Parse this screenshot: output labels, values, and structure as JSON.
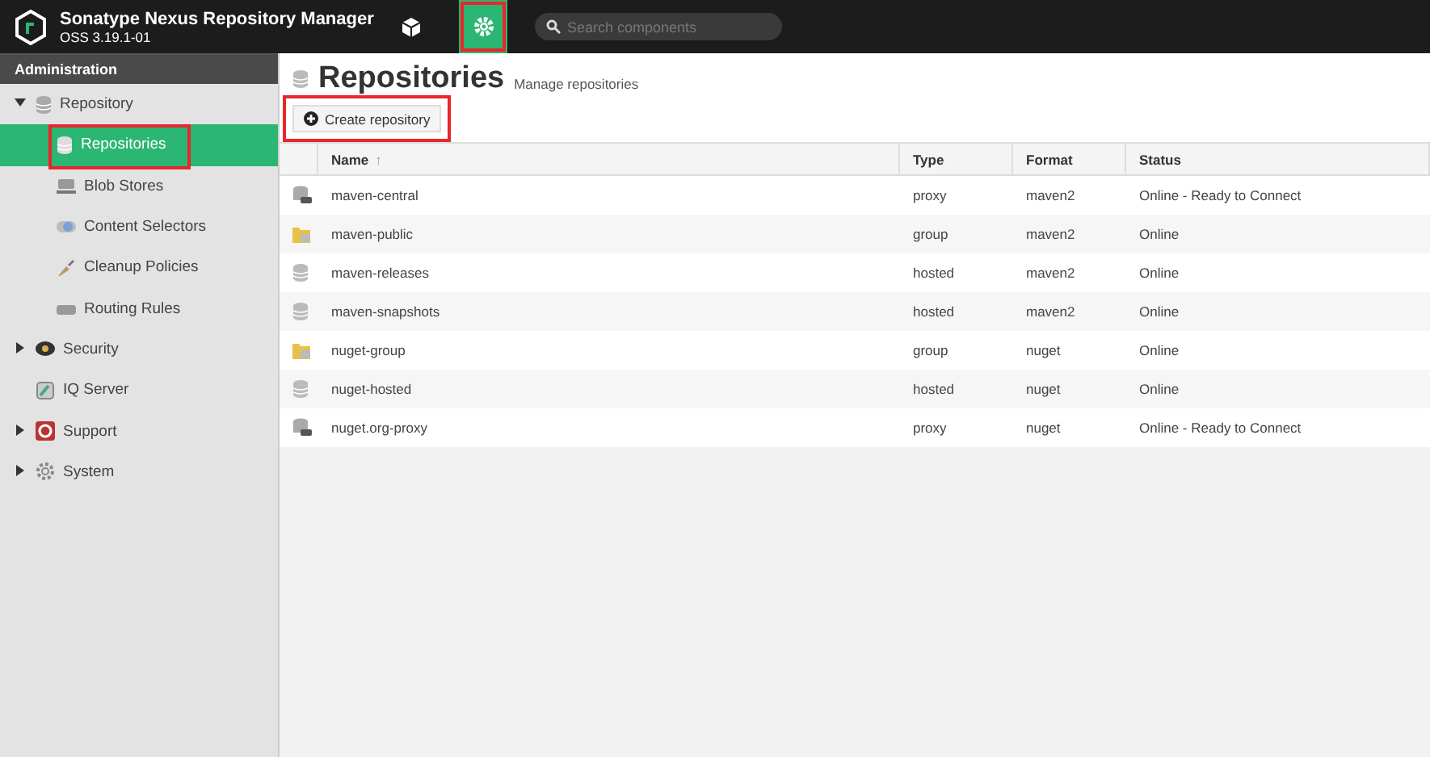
{
  "header": {
    "title": "Sonatype Nexus Repository Manager",
    "version": "OSS 3.19.1-01",
    "nav": [
      {
        "kind": "browse",
        "selected": false,
        "highlighted": false
      },
      {
        "kind": "admin",
        "selected": true,
        "highlighted": true
      }
    ],
    "search": {
      "placeholder": "Search components"
    }
  },
  "sidebar": {
    "title": "Administration",
    "items": [
      {
        "label": "Repository",
        "kind": "database",
        "expanded": true,
        "selected": false,
        "highlighted": false,
        "children": [
          {
            "label": "Repositories",
            "kind": "database",
            "selected": true,
            "highlighted": true
          },
          {
            "label": "Blob Stores",
            "kind": "server",
            "selected": false,
            "highlighted": false
          },
          {
            "label": "Content Selectors",
            "kind": "selector",
            "selected": false,
            "highlighted": false
          },
          {
            "label": "Cleanup Policies",
            "kind": "brush",
            "selected": false,
            "highlighted": false
          },
          {
            "label": "Routing Rules",
            "kind": "drive",
            "selected": false,
            "highlighted": false
          }
        ]
      },
      {
        "label": "Security",
        "kind": "badge",
        "expanded": false,
        "selected": false,
        "highlighted": false
      },
      {
        "label": "IQ Server",
        "kind": "iq",
        "selected": false,
        "highlighted": false
      },
      {
        "label": "Support",
        "kind": "lifebuoy",
        "expanded": false,
        "selected": false,
        "highlighted": false
      },
      {
        "label": "System",
        "kind": "gear",
        "expanded": false,
        "selected": false,
        "highlighted": false
      }
    ]
  },
  "page": {
    "title": "Repositories",
    "subtitle": "Manage repositories",
    "create_button": {
      "label": "Create repository",
      "highlighted": true
    }
  },
  "table": {
    "columns": [
      "Name",
      "Type",
      "Format",
      "Status"
    ],
    "sort_indicator": "↑",
    "rows": [
      {
        "kind": "proxy",
        "name": "maven-central",
        "type": "proxy",
        "format": "maven2",
        "status": "Online - Ready to Connect"
      },
      {
        "kind": "group",
        "name": "maven-public",
        "type": "group",
        "format": "maven2",
        "status": "Online"
      },
      {
        "kind": "hosted",
        "name": "maven-releases",
        "type": "hosted",
        "format": "maven2",
        "status": "Online"
      },
      {
        "kind": "hosted",
        "name": "maven-snapshots",
        "type": "hosted",
        "format": "maven2",
        "status": "Online"
      },
      {
        "kind": "group",
        "name": "nuget-group",
        "type": "group",
        "format": "nuget",
        "status": "Online"
      },
      {
        "kind": "hosted",
        "name": "nuget-hosted",
        "type": "hosted",
        "format": "nuget",
        "status": "Online"
      },
      {
        "kind": "proxy",
        "name": "nuget.org-proxy",
        "type": "proxy",
        "format": "nuget",
        "status": "Online - Ready to Connect"
      }
    ]
  }
}
